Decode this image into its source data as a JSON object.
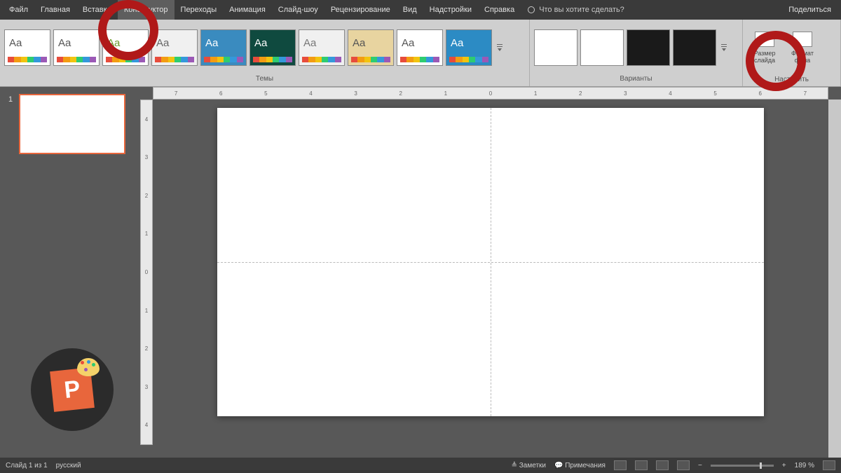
{
  "menu": {
    "items": [
      "Файл",
      "Главная",
      "Вставка",
      "Конструктор",
      "Переходы",
      "Анимация",
      "Слайд-шоу",
      "Рецензирование",
      "Вид",
      "Надстройки",
      "Справка"
    ],
    "active_index": 3,
    "tell_me": "Что вы хотите сделать?",
    "share": "Поделиться"
  },
  "ribbon": {
    "themes_label": "Темы",
    "variants_label": "Варианты",
    "settings_label": "Настроить",
    "slide_size": "Размер слайда",
    "format_bg": "Формат фона",
    "theme_styles": [
      {
        "bg": "#ffffff",
        "txt": "#555"
      },
      {
        "bg": "#ffffff",
        "txt": "#555"
      },
      {
        "bg": "#ffffff",
        "txt": "#6a9a2a"
      },
      {
        "bg": "#f0f0f0",
        "txt": "#666"
      },
      {
        "bg": "#3a8bbf",
        "txt": "#fff"
      },
      {
        "bg": "#0f4a3f",
        "txt": "#fff"
      },
      {
        "bg": "#f0f0f0",
        "txt": "#777"
      },
      {
        "bg": "#e8d4a0",
        "txt": "#555"
      },
      {
        "bg": "#ffffff",
        "txt": "#555"
      },
      {
        "bg": "#2c8bc4",
        "txt": "#fff"
      }
    ],
    "variants": [
      {
        "bg": "#ffffff"
      },
      {
        "bg": "#ffffff"
      },
      {
        "bg": "#1a1a1a"
      },
      {
        "bg": "#1a1a1a"
      }
    ]
  },
  "rulers": {
    "h": [
      "7",
      "6",
      "5",
      "4",
      "3",
      "2",
      "1",
      "0",
      "1",
      "2",
      "3",
      "4",
      "5",
      "6",
      "7"
    ],
    "v": [
      "4",
      "3",
      "2",
      "1",
      "0",
      "1",
      "2",
      "3",
      "4"
    ]
  },
  "slidenav": {
    "current_num": "1"
  },
  "status": {
    "slide_of": "Слайд 1 из 1",
    "lang": "русский",
    "notes": "Заметки",
    "comments": "Примечания",
    "zoom": "189 %"
  }
}
